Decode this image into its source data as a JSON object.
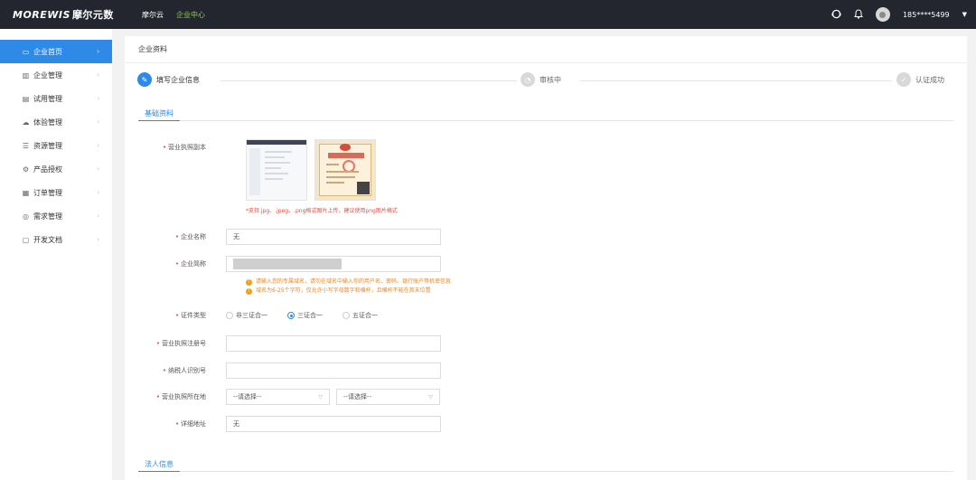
{
  "topbar": {
    "logo_text": "MOREWIS",
    "logo_cn": "摩尔元数",
    "nav": [
      {
        "label": "摩尔云",
        "active": false
      },
      {
        "label": "企业中心",
        "active": true
      }
    ],
    "user": "185****5499"
  },
  "sidebar": {
    "items": [
      {
        "label": "企业首页",
        "icon": "monitor-icon",
        "active": true
      },
      {
        "label": "企业管理",
        "icon": "building-icon",
        "active": false
      },
      {
        "label": "试用管理",
        "icon": "box-icon",
        "active": false
      },
      {
        "label": "体验管理",
        "icon": "cloud-icon",
        "active": false
      },
      {
        "label": "资源管理",
        "icon": "list-icon",
        "active": false
      },
      {
        "label": "产品授权",
        "icon": "gear-icon",
        "active": false
      },
      {
        "label": "订单管理",
        "icon": "clipboard-icon",
        "active": false
      },
      {
        "label": "需求管理",
        "icon": "location-icon",
        "active": false
      },
      {
        "label": "开发文档",
        "icon": "folder-icon",
        "active": false
      }
    ]
  },
  "main": {
    "page_title": "企业资料",
    "steps": [
      {
        "label": "填写企业信息",
        "active": true
      },
      {
        "label": "审核中",
        "active": false
      },
      {
        "label": "认证成功",
        "active": false
      }
    ],
    "section_basic": "基础资料",
    "section_legal": "法人信息",
    "form": {
      "license_copy_label": "营业执照副本",
      "upload_hint": "*支持.jpg、.jpeg、.png格式图片上传，建议使用png图片格式",
      "company_name_label": "企业名称",
      "company_name_value": "无",
      "company_short_label": "企业简称",
      "tips": [
        "请输入您的专属域名，请勿在域名中输入你的用户名、密码、银行账户等机密信息",
        "域名为6-25个字符，仅允许小写字母数字和横杆，且横杆不能在首末位置"
      ],
      "cert_type_label": "证件类型",
      "cert_options": [
        {
          "label": "非三证合一",
          "checked": false
        },
        {
          "label": "三证合一",
          "checked": true
        },
        {
          "label": "五证合一",
          "checked": false
        }
      ],
      "reg_no_label": "营业执照注册号",
      "taxpayer_label": "纳税人识别号",
      "location_label": "营业执照所在地",
      "select_placeholder_1": "--请选择--",
      "select_placeholder_2": "--请选择--",
      "address_label": "详细地址",
      "address_value": "无"
    }
  }
}
